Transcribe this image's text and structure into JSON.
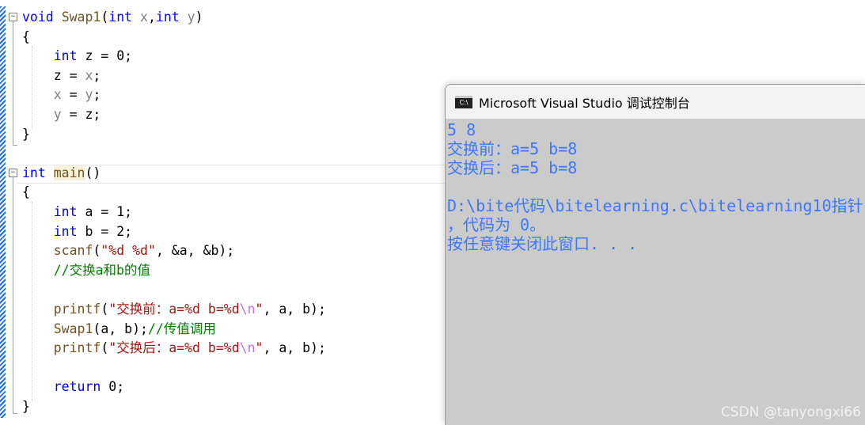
{
  "editor": {
    "lines": [
      [
        [
          "void",
          "kw"
        ],
        [
          " ",
          ""
        ],
        [
          "Swap1",
          "fn"
        ],
        [
          "(",
          ""
        ],
        [
          "int",
          "kw"
        ],
        [
          " ",
          ""
        ],
        [
          "x",
          "par"
        ],
        [
          ",",
          ""
        ],
        [
          "int",
          "kw"
        ],
        [
          " ",
          ""
        ],
        [
          "y",
          "par"
        ],
        [
          ")",
          ""
        ]
      ],
      [
        [
          "{",
          ""
        ]
      ],
      [
        [
          "    ",
          ""
        ],
        [
          "int",
          "kw"
        ],
        [
          " z = 0;",
          ""
        ]
      ],
      [
        [
          "    z = ",
          ""
        ],
        [
          "x",
          "par"
        ],
        [
          ";",
          ""
        ]
      ],
      [
        [
          "    ",
          ""
        ],
        [
          "x",
          "par"
        ],
        [
          " = ",
          ""
        ],
        [
          "y",
          "par"
        ],
        [
          ";",
          ""
        ]
      ],
      [
        [
          "    ",
          ""
        ],
        [
          "y",
          "par"
        ],
        [
          " = z;",
          ""
        ]
      ],
      [
        [
          "}",
          ""
        ]
      ],
      [],
      [
        [
          "int",
          "kw"
        ],
        [
          " ",
          ""
        ],
        [
          "main",
          "fn hl"
        ],
        [
          "()",
          ""
        ]
      ],
      [
        [
          "{",
          ""
        ]
      ],
      [
        [
          "    ",
          ""
        ],
        [
          "int",
          "kw"
        ],
        [
          " a = 1;",
          ""
        ]
      ],
      [
        [
          "    ",
          ""
        ],
        [
          "int",
          "kw"
        ],
        [
          " b = 2;",
          ""
        ]
      ],
      [
        [
          "    ",
          ""
        ],
        [
          "scanf",
          "fn"
        ],
        [
          "(",
          ""
        ],
        [
          "\"%d %d\"",
          "str"
        ],
        [
          ", &a, &b);",
          ""
        ]
      ],
      [
        [
          "    ",
          ""
        ],
        [
          "//交换a和b的值",
          "cm"
        ]
      ],
      [],
      [
        [
          "    ",
          ""
        ],
        [
          "printf",
          "fn"
        ],
        [
          "(",
          ""
        ],
        [
          "\"交换前：a=%d b=%d",
          "str"
        ],
        [
          "\\n",
          "esc"
        ],
        [
          "\"",
          "str"
        ],
        [
          ", a, b);",
          ""
        ]
      ],
      [
        [
          "    ",
          ""
        ],
        [
          "Swap1",
          "fn"
        ],
        [
          "(a, b);",
          ""
        ],
        [
          "//传值调用",
          "cm"
        ]
      ],
      [
        [
          "    ",
          ""
        ],
        [
          "printf",
          "fn"
        ],
        [
          "(",
          ""
        ],
        [
          "\"交换后：a=%d b=%d",
          "str"
        ],
        [
          "\\n",
          "esc"
        ],
        [
          "\"",
          "str"
        ],
        [
          ", a, b);",
          ""
        ]
      ],
      [],
      [
        [
          "    ",
          ""
        ],
        [
          "return",
          "kw"
        ],
        [
          " 0;",
          ""
        ]
      ],
      [
        [
          "}",
          ""
        ]
      ]
    ]
  },
  "console": {
    "title": "Microsoft Visual Studio 调试控制台",
    "icon_label": "C:\\",
    "lines": [
      "5 8",
      "交换前：a=5 b=8",
      "交换后：a=5 b=8",
      "",
      "D:\\bite代码\\bitelearning.c\\bitelearning10指针",
      "，代码为 0。",
      "按任意键关闭此窗口. . ."
    ]
  },
  "watermark": "CSDN @tanyongxi66"
}
